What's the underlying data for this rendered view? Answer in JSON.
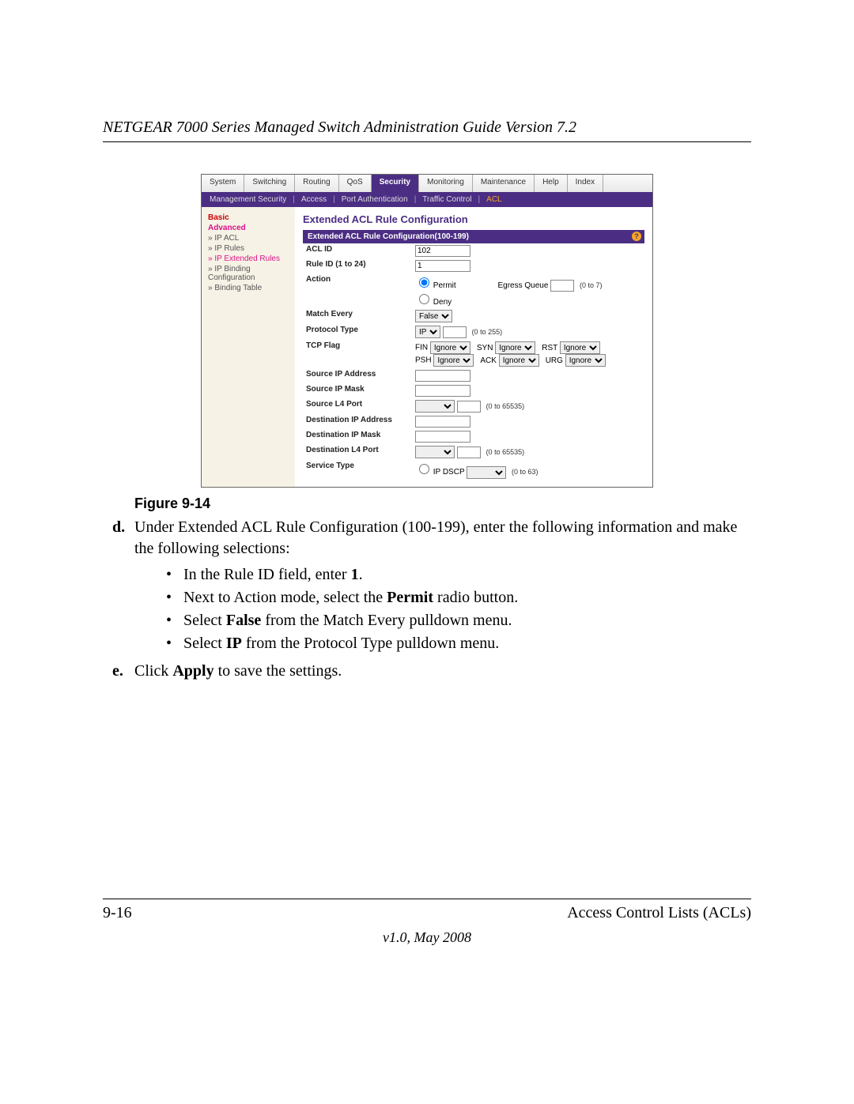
{
  "doc": {
    "header": "NETGEAR 7000 Series Managed Switch Administration Guide Version 7.2",
    "figure_caption": "Figure 9-14",
    "step_d_lead": "d.",
    "step_d_text": "Under Extended ACL Rule Configuration (100-199), enter the following information and make the following selections:",
    "bullets": [
      {
        "pre": "In the Rule ID field, enter ",
        "bold": "1",
        "post": "."
      },
      {
        "pre": "Next to Action mode, select the ",
        "bold": "Permit",
        "post": " radio button."
      },
      {
        "pre": "Select ",
        "bold": "False",
        "post": " from the Match Every pulldown menu."
      },
      {
        "pre": "Select ",
        "bold": "IP",
        "post": " from the Protocol Type pulldown menu."
      }
    ],
    "step_e_lead": "e.",
    "step_e_pre": "Click ",
    "step_e_bold": "Apply",
    "step_e_post": " to save the settings.",
    "foot_left": "9-16",
    "foot_right": "Access Control Lists (ACLs)",
    "foot_center": "v1.0, May 2008"
  },
  "ui": {
    "tabs": [
      "System",
      "Switching",
      "Routing",
      "QoS",
      "Security",
      "Monitoring",
      "Maintenance",
      "Help",
      "Index"
    ],
    "active_tab_index": 4,
    "subtabs": [
      "Management Security",
      "Access",
      "Port Authentication",
      "Traffic Control",
      "ACL"
    ],
    "active_subtab_index": 4,
    "side": {
      "basic": "Basic",
      "advanced": "Advanced",
      "items": [
        "IP ACL",
        "IP Rules",
        "IP Extended Rules",
        "IP Binding Configuration",
        "Binding Table"
      ],
      "highlight_index": 2
    },
    "panel_title": "Extended ACL Rule Configuration",
    "panel_subtitle": "Extended ACL Rule Configuration(100-199)",
    "help_icon": "?",
    "rows": {
      "acl_id": {
        "label": "ACL ID",
        "value": "102"
      },
      "rule_id": {
        "label": "Rule ID (1 to 24)",
        "value": "1"
      },
      "action": {
        "label": "Action",
        "permit": "Permit",
        "deny": "Deny",
        "egress_label": "Egress Queue",
        "egress_value": "",
        "egress_hint": "(0 to 7)"
      },
      "match_every": {
        "label": "Match Every",
        "value": "False"
      },
      "protocol": {
        "label": "Protocol Type",
        "value": "IP",
        "hint": "(0 to 255)"
      },
      "tcp_flag": {
        "label": "TCP Flag",
        "flags": [
          {
            "name": "FIN",
            "value": "Ignore"
          },
          {
            "name": "SYN",
            "value": "Ignore"
          },
          {
            "name": "RST",
            "value": "Ignore"
          },
          {
            "name": "PSH",
            "value": "Ignore"
          },
          {
            "name": "ACK",
            "value": "Ignore"
          },
          {
            "name": "URG",
            "value": "Ignore"
          }
        ]
      },
      "src_ip": {
        "label": "Source IP Address",
        "value": ""
      },
      "src_mask": {
        "label": "Source IP Mask",
        "value": ""
      },
      "src_port": {
        "label": "Source L4 Port",
        "value": "",
        "hint": "(0 to 65535)"
      },
      "dst_ip": {
        "label": "Destination IP Address",
        "value": ""
      },
      "dst_mask": {
        "label": "Destination IP Mask",
        "value": ""
      },
      "dst_port": {
        "label": "Destination L4 Port",
        "value": "",
        "hint": "(0 to 65535)"
      },
      "svc_type": {
        "label": "Service Type",
        "value": "IP DSCP",
        "hint": "(0 to 63)"
      }
    }
  }
}
